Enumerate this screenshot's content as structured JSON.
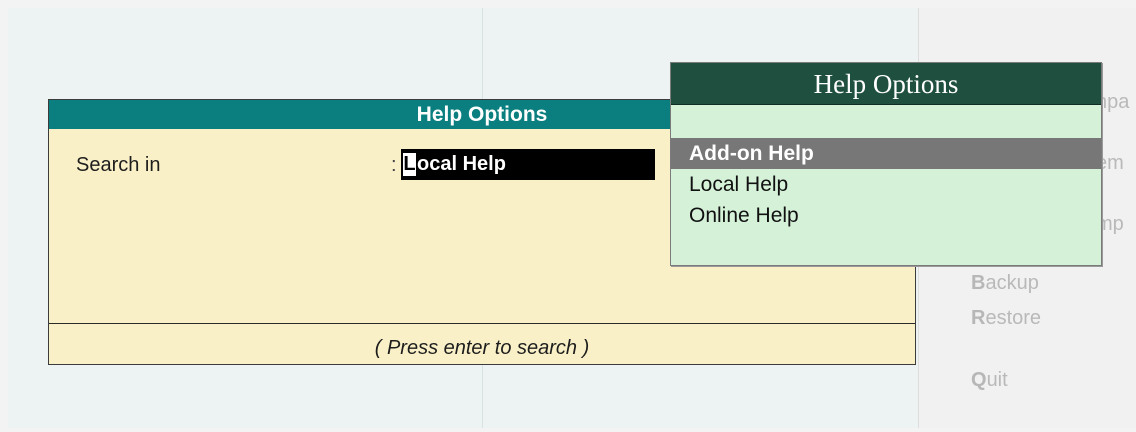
{
  "background": {
    "menu_items": [
      {
        "text": "npa",
        "bold_prefix": ""
      },
      {
        "text": "em",
        "bold_prefix": ""
      },
      {
        "text": "mp",
        "bold_prefix": ""
      },
      {
        "text": "ackup",
        "bold_prefix": "B"
      },
      {
        "text": "estore",
        "bold_prefix": "R"
      },
      {
        "text": "uit",
        "bold_prefix": "Q"
      }
    ]
  },
  "dialog": {
    "title": "Help Options",
    "field_label": "Search in",
    "field_colon": ":",
    "field_value_first": "L",
    "field_value_rest": "ocal Help",
    "footer": "( Press enter to search )"
  },
  "popup": {
    "title": "Help Options",
    "items": [
      {
        "label": "Add-on Help",
        "selected": true
      },
      {
        "label": "Local Help",
        "selected": false
      },
      {
        "label": "Online Help",
        "selected": false
      }
    ]
  },
  "colors": {
    "dialog_title_bg": "#0b7f7f",
    "dialog_bg": "#faf0c8",
    "popup_title_bg": "#1e4f3f",
    "popup_bg": "#d5f2d9",
    "selected_bg": "#777777"
  }
}
